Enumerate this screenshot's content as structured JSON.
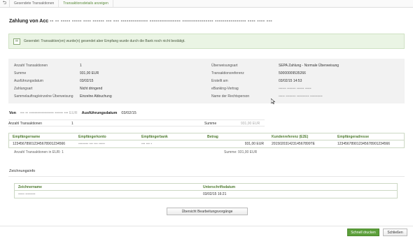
{
  "topbar": {
    "back_icon": "arrow-back-icon",
    "crumbs": [
      "Gesendete Transaktionen",
      "Transaktionsdetails anzeigen"
    ]
  },
  "page": {
    "title_prefix": "Zahlung von Acc",
    "title_blur": "▪▪ ▪▪ ▪▪▪▪▪ ▪▪▪▪▪ ▪▪▪▪ ▪▪▪▪▪▪ ▪▪▪ ▪▪▪ ▪▪▪▪▪▪▪▪▪▪▪▪▪▪ ▪▪▪▪▪▪▪▪▪▪▪▪▪▪▪▪ ▪▪▪▪▪▪▪▪▪▪▪▪▪▪▪▪ ▪▪▪▪▪▪▪▪▪▪▪▪▪▪▪▪ ▪▪▪▪ ▪▪▪▪ ▪▪▪"
  },
  "alert": {
    "icon": "envelope-icon",
    "text": "Gesendet: Transaktion(en) wurde(n) gesendet aber Empfang wurde durch die Bank noch nicht bestätigt."
  },
  "details": {
    "left": [
      {
        "label": "Anzahl Transaktionen",
        "value": "1"
      },
      {
        "label": "Summe",
        "value": "931,00 EUR"
      },
      {
        "label": "Ausführungsdatum",
        "value": "03/02/15"
      },
      {
        "label": "Zahlungsart",
        "value": "Nicht dringend"
      },
      {
        "label": "Sammelauftrag/einzelne Überweisung",
        "value": "Einzelne Abbuchung"
      }
    ],
    "right": [
      {
        "label": "Überweisungsart",
        "value": "SEPA Zahlung - Normale Überweisung"
      },
      {
        "label": "Transaktionsreferenz",
        "value": "50000009535266"
      },
      {
        "label": "Erstellt am",
        "value": "03/02/15 14:53"
      },
      {
        "label": "eBanking-Vertrag",
        "value": "▪▪▪▪▪▪ ▪▪▪▪▪▪▪ ▪▪▪▪▪▪ ▪▪▪▪▪"
      },
      {
        "label": "Name der Rechtsperson",
        "value": "▪▪▪▪▪ ▪▪▪▪▪▪▪▪ ▪▪▪▪▪▪▪▪▪▪ ▪▪▪▪▪▪▪▪▪▪"
      }
    ]
  },
  "von": {
    "label": "Von",
    "value": "▪▪▪ ▪▪ ▪▪▪▪▪▪▪▪▪▪▪▪▪▪▪▪▪▪ ▪▪▪▪▪▪ ▪▪▪ EUR",
    "date_label": "Ausführungsdatum",
    "date_value": "03/02/15"
  },
  "summary": {
    "count_label": "Anzahl Transaktionen",
    "count_value": "1",
    "sum_label": "Summe",
    "sum_value": "931,00 EUR"
  },
  "payments": {
    "columns": [
      "Empfängername",
      "Empfängerkonto",
      "Empfängerbank",
      "Betrag",
      "Kundenreferenz (E2E)",
      "Empfängeradresse"
    ],
    "rows": [
      [
        "123456789012345678901234566",
        "▪▪▪▪▪▪▪▪ ▪▪▪ ▪▪▪ ▪▪▪▪▪",
        "▪▪▪ ▪▪▪ ▪",
        "931,00 EUR",
        "20150203142314567899TE",
        "123456789012345678901234566"
      ]
    ],
    "footer_count": "Anzahl Transaktionen in EUR: 1",
    "footer_sum": "Summe: 931,00 EUR"
  },
  "signature": {
    "section_title": "Zeichnungsinfo",
    "columns": [
      "Zeichnername",
      "Unterschriftsdatum"
    ],
    "rows": [
      [
        "▪▪▪▪▪ ▪▪▪▪▪▪▪▪",
        "03/02/15 16:21"
      ]
    ]
  },
  "buttons": {
    "overview": "Übersicht Bearbeitungsvorgänge",
    "print": "Schnell drucken",
    "close": "Schließen"
  }
}
